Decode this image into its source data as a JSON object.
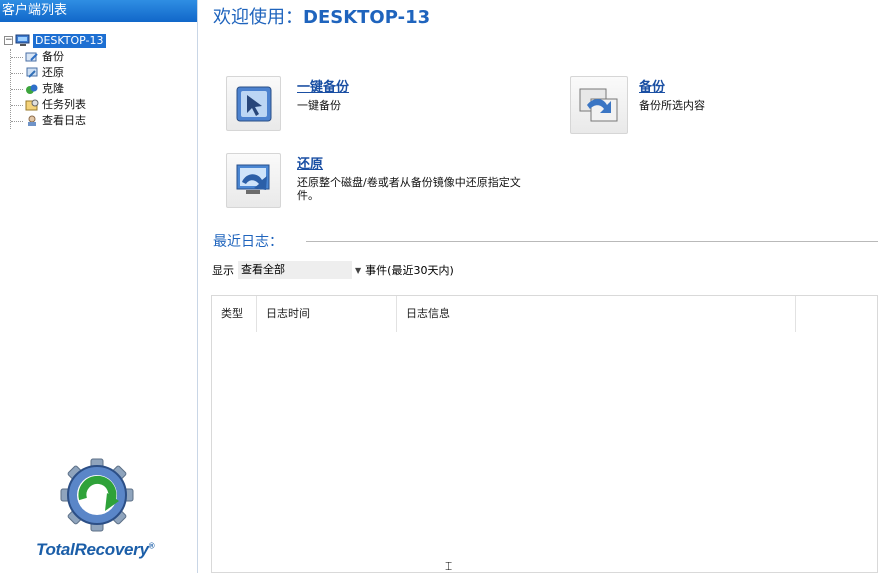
{
  "sidebar": {
    "header": "客户端列表",
    "root": "DESKTOP-13",
    "items": [
      {
        "label": "备份",
        "icon": "backup-icon"
      },
      {
        "label": "还原",
        "icon": "restore-icon"
      },
      {
        "label": "克隆",
        "icon": "clone-icon"
      },
      {
        "label": "任务列表",
        "icon": "task-list-icon"
      },
      {
        "label": "查看日志",
        "icon": "view-log-icon"
      }
    ],
    "logo_text": "TotalRecovery",
    "logo_mark": "®"
  },
  "main": {
    "welcome_prefix": "欢迎使用：",
    "welcome_host": "DESKTOP-13",
    "actions": [
      {
        "title": "一键备份",
        "desc": "一键备份"
      },
      {
        "title": "备份",
        "desc": "备份所选内容"
      },
      {
        "title": "还原",
        "desc": "还原整个磁盘/卷或者从备份镜像中还原指定文件。"
      }
    ],
    "recent_title": "最近日志：",
    "filter": {
      "label": "显示",
      "selected": "查看全部",
      "suffix": "事件(最近30天内)"
    },
    "table": {
      "columns": [
        "类型",
        "日志时间",
        "日志信息",
        ""
      ]
    }
  },
  "colors": {
    "accent": "#1f64bd",
    "sidebar_header": "#1167c9",
    "selection": "#1d6fd2"
  }
}
